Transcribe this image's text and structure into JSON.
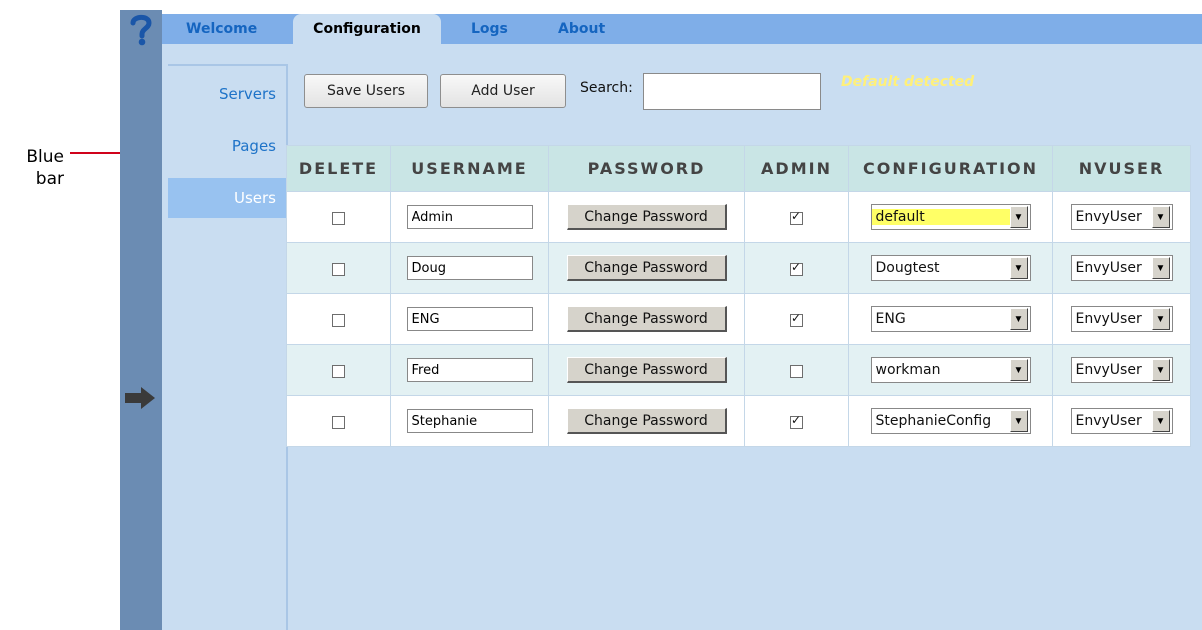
{
  "annotation": {
    "label_line1": "Blue",
    "label_line2": "bar"
  },
  "tabs": [
    {
      "label": "Welcome",
      "active": false
    },
    {
      "label": "Configuration",
      "active": true
    },
    {
      "label": "Logs",
      "active": false
    },
    {
      "label": "About",
      "active": false
    }
  ],
  "sidenav": [
    {
      "label": "Servers",
      "active": false
    },
    {
      "label": "Pages",
      "active": false
    },
    {
      "label": "Users",
      "active": true
    }
  ],
  "toolbar": {
    "save_label": "Save Users",
    "add_label": "Add User",
    "search_label": "Search:",
    "search_value": "",
    "status_text": "Default detected"
  },
  "table": {
    "headers": [
      "DELETE",
      "USERNAME",
      "PASSWORD",
      "ADMIN",
      "CONFIGURATION",
      "NVUSER"
    ],
    "password_button_label": "Change Password",
    "rows": [
      {
        "delete": false,
        "username": "Admin",
        "admin": true,
        "configuration": "default",
        "nvuser": "EnvyUser"
      },
      {
        "delete": false,
        "username": "Doug",
        "admin": true,
        "configuration": "Dougtest",
        "nvuser": "EnvyUser"
      },
      {
        "delete": false,
        "username": "ENG",
        "admin": true,
        "configuration": "ENG",
        "nvuser": "EnvyUser"
      },
      {
        "delete": false,
        "username": "Fred",
        "admin": false,
        "configuration": "workman",
        "nvuser": "EnvyUser"
      },
      {
        "delete": false,
        "username": "Stephanie",
        "admin": true,
        "configuration": "StephanieConfig",
        "nvuser": "EnvyUser"
      }
    ]
  },
  "colors": {
    "blue_bar": "#6b8cb3",
    "tab_bar": "#7faee8",
    "panel": "#c9ddf1",
    "status_text": "#fff07a",
    "annotation_arrow": "#d0021b",
    "highlight": "#ffff66"
  },
  "icons": {
    "help": "question-mark-icon",
    "expand": "right-arrow-icon"
  }
}
